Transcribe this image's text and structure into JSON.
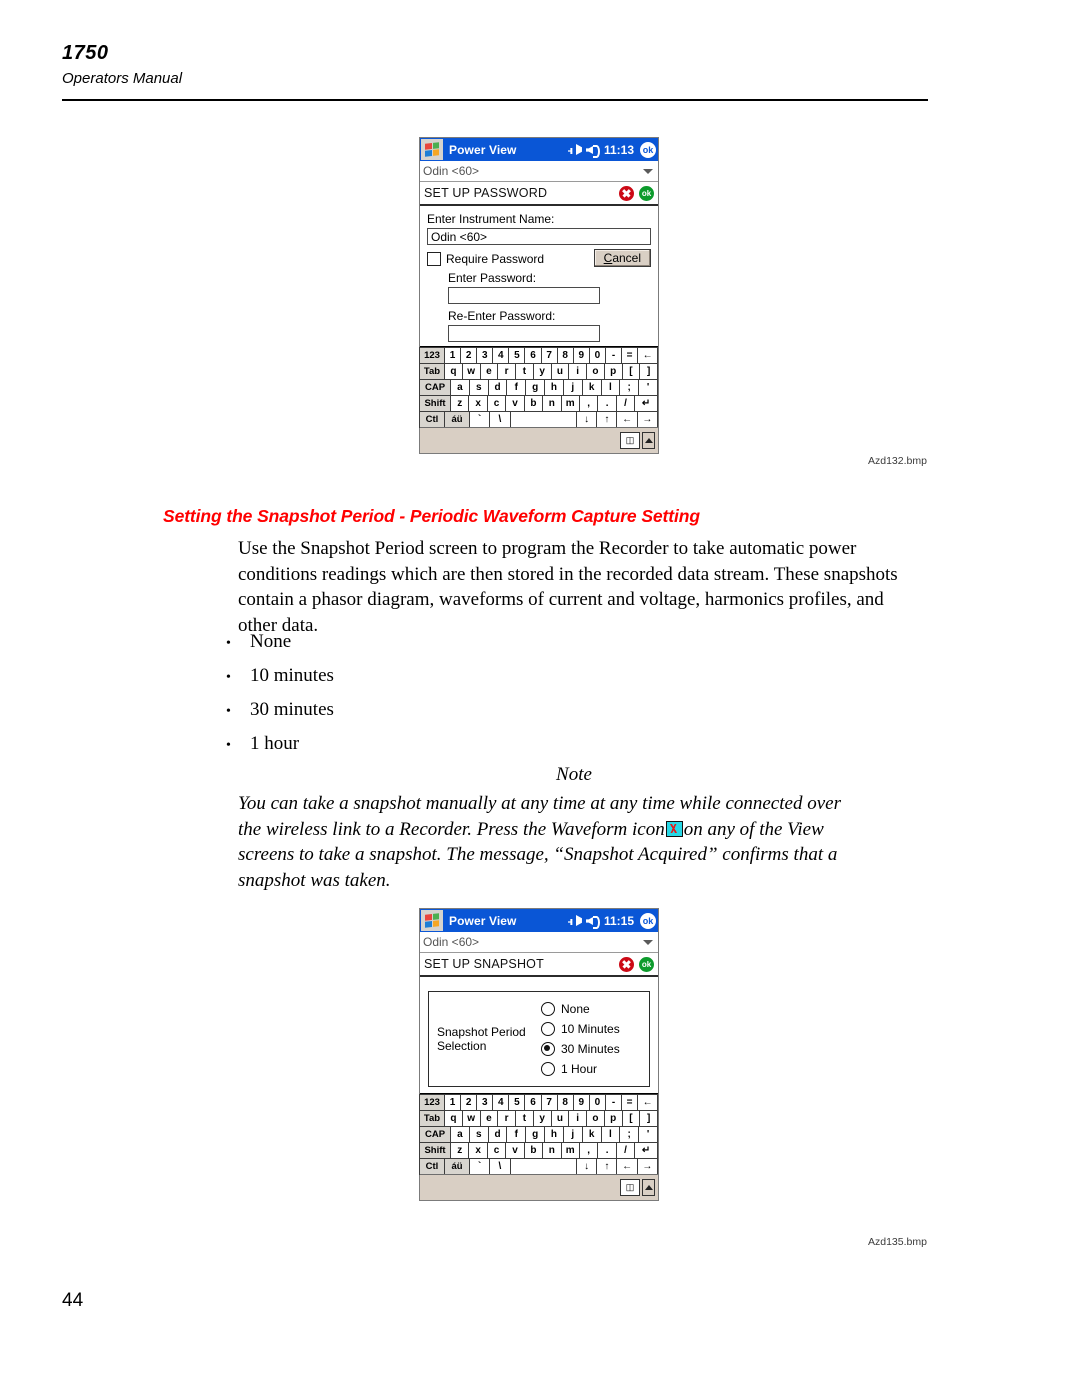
{
  "header": {
    "doc_number": "1750",
    "doc_subtitle": "Operators Manual"
  },
  "screenshot_password": {
    "titlebar": {
      "app_name": "Power View",
      "time": "11:13",
      "ok_label": "ok",
      "start_icon": "windows-flag-icon",
      "connectivity_icon": "connectivity-icon",
      "volume_icon": "speaker-icon"
    },
    "device_combo": {
      "value": "Odin <60>"
    },
    "section": {
      "title": "SET UP PASSWORD",
      "close_label": "",
      "ok_label": "ok"
    },
    "form": {
      "instrument_name_label": "Enter Instrument Name:",
      "instrument_name_value": "Odin <60>",
      "require_password_label": "Require Password",
      "require_password_checked": false,
      "cancel_button": "Cancel",
      "enter_password_label": "Enter Password:",
      "enter_password_value": "",
      "reenter_password_label": "Re-Enter Password:",
      "reenter_password_value": ""
    },
    "caption": "Azd132.bmp"
  },
  "screenshot_snapshot": {
    "titlebar": {
      "app_name": "Power View",
      "time": "11:15",
      "ok_label": "ok",
      "start_icon": "windows-flag-icon",
      "connectivity_icon": "connectivity-icon",
      "volume_icon": "speaker-icon"
    },
    "device_combo": {
      "value": "Odin <60>"
    },
    "section": {
      "title": "SET UP SNAPSHOT",
      "ok_label": "ok"
    },
    "radio_group": {
      "legend_line1": "Snapshot Period",
      "legend_line2": "Selection",
      "options": [
        {
          "label": "None",
          "selected": false
        },
        {
          "label": "10 Minutes",
          "selected": false
        },
        {
          "label": "30 Minutes",
          "selected": true
        },
        {
          "label": "1 Hour",
          "selected": false
        }
      ]
    },
    "caption": "Azd135.bmp"
  },
  "keyboard": {
    "row1": [
      "123",
      "1",
      "2",
      "3",
      "4",
      "5",
      "6",
      "7",
      "8",
      "9",
      "0",
      "-",
      "=",
      "←"
    ],
    "row2": [
      "Tab",
      "q",
      "w",
      "e",
      "r",
      "t",
      "y",
      "u",
      "i",
      "o",
      "p",
      "[",
      "]"
    ],
    "row3": [
      "CAP",
      "a",
      "s",
      "d",
      "f",
      "g",
      "h",
      "j",
      "k",
      "l",
      ";",
      "'"
    ],
    "row4": [
      "Shift",
      "z",
      "x",
      "c",
      "v",
      "b",
      "n",
      "m",
      ",",
      ".",
      "/",
      "↵"
    ],
    "row5": [
      "Ctl",
      "áü",
      "`",
      "\\",
      "",
      "↓",
      "↑",
      "←",
      "→"
    ],
    "footer_keyboard_icon": "keyboard-icon",
    "footer_up_icon": "caret-up-icon"
  },
  "article": {
    "heading": "Setting the Snapshot Period - Periodic Waveform Capture Setting",
    "paragraph": "Use the Snapshot Period screen to program the Recorder to take automatic power conditions readings which are then stored in the recorded data stream. These snapshots contain a phasor diagram, waveforms of current and voltage, harmonics profiles, and other data.",
    "bullets": [
      "None",
      "10 minutes",
      "30 minutes",
      "1 hour"
    ],
    "bullet_marker": "•",
    "note_title": "Note",
    "note_part1": "You can take a snapshot manually at any time at any time while connected over the wireless link to a Recorder. Press the Waveform icon",
    "note_icon": "waveform-icon",
    "note_part2": "on any of the View screens to take a snapshot. The message, “Snapshot Acquired” confirms that a snapshot was taken."
  },
  "footer": {
    "page_number": "44"
  },
  "colors": {
    "heading_red": "#ff0000",
    "titlebar_blue": "#0a56d6",
    "ok_green": "#0d9b2c",
    "close_red": "#cc0a16",
    "keyboard_beige": "#d9cfc4"
  }
}
